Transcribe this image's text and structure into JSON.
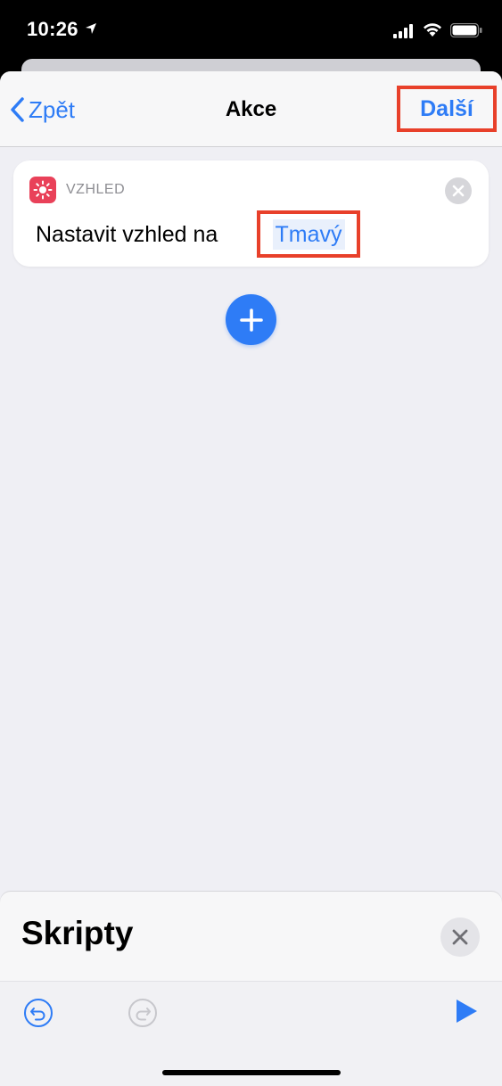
{
  "status_bar": {
    "time": "10:26"
  },
  "nav": {
    "back_label": "Zpět",
    "title": "Akce",
    "next_label": "Další"
  },
  "action": {
    "category": "VZHLED",
    "text": "Nastavit vzhled na",
    "parameter_value": "Tmavý",
    "icon": "appearance-sun-icon"
  },
  "panel": {
    "title": "Skripty"
  },
  "toolbar": {
    "undo_icon": "undo-icon",
    "redo_icon": "redo-icon",
    "run_icon": "play-icon"
  },
  "colors": {
    "accent": "#2e7cf6",
    "highlight_border": "#e8402a",
    "action_icon_bg": "#e94159"
  }
}
